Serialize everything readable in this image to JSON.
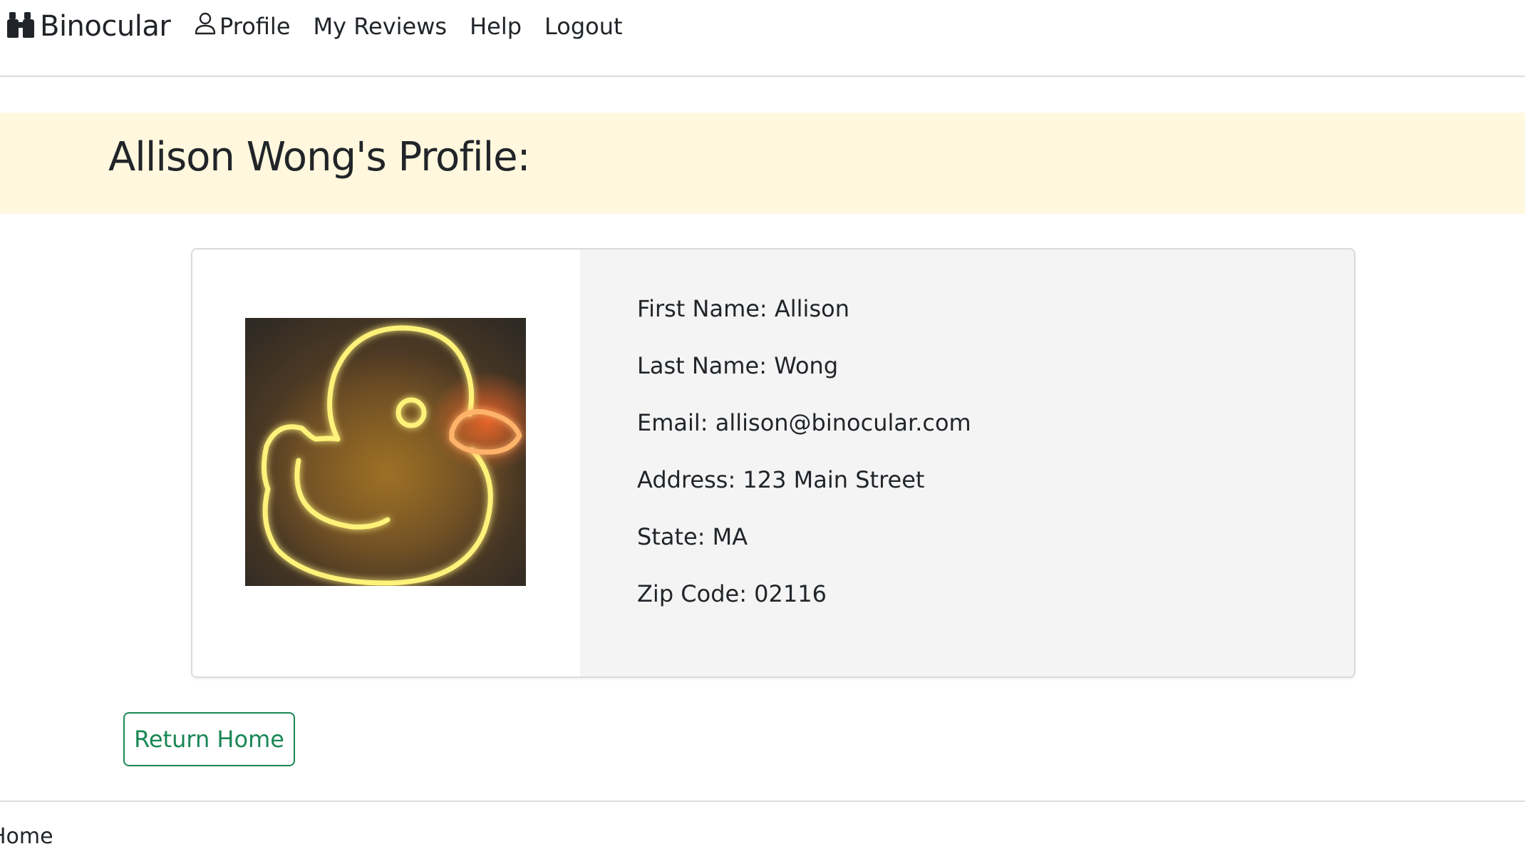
{
  "navbar": {
    "brand": "Binocular",
    "brand_icon": "binoculars-icon",
    "links": [
      {
        "label": "Profile",
        "icon": "person-icon"
      },
      {
        "label": "My Reviews"
      },
      {
        "label": "Help"
      },
      {
        "label": "Logout"
      }
    ]
  },
  "banner": {
    "title": "Allison Wong's Profile:",
    "background": "#fff8de"
  },
  "profile": {
    "avatar_icon": "neon-duck-image",
    "details": [
      "First Name: Allison",
      "Last Name: Wong",
      "Email: allison@binocular.com",
      "Address: 123 Main Street",
      "State: MA",
      "Zip Code: 02116"
    ]
  },
  "actions": {
    "return_label": "Return Home",
    "accent": "#198754"
  },
  "footer": {
    "text": "Home"
  }
}
